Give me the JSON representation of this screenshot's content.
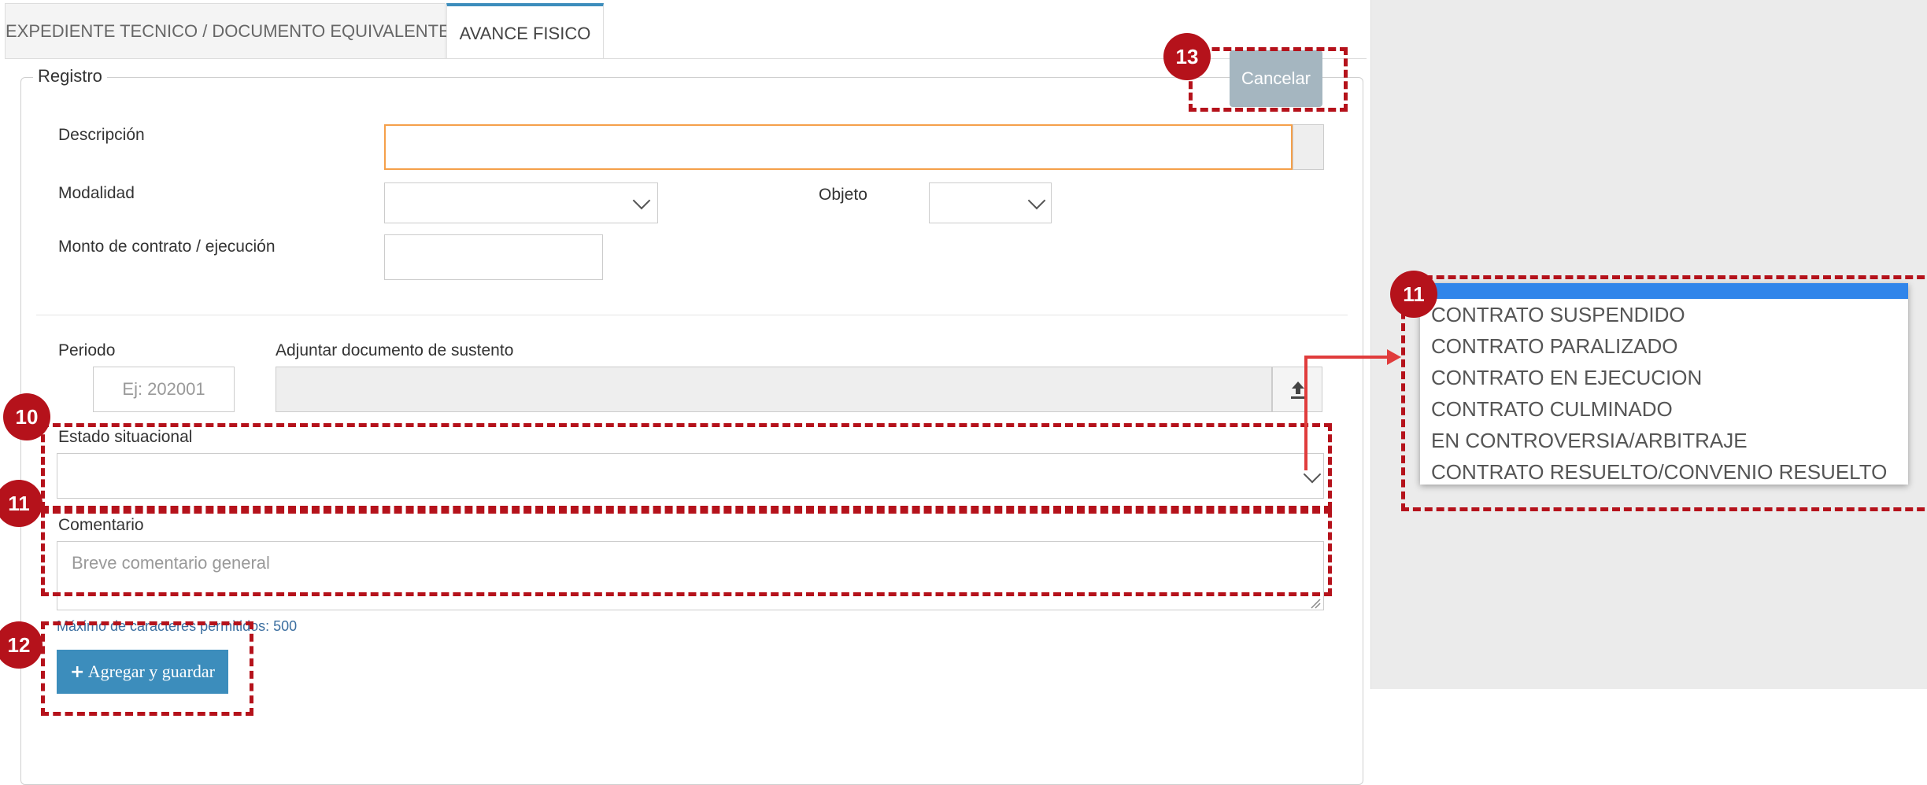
{
  "tabs": [
    {
      "label": "EXPEDIENTE TECNICO / DOCUMENTO EQUIVALENTE"
    },
    {
      "label": "AVANCE FISICO"
    }
  ],
  "form": {
    "legend": "Registro",
    "cancel_label": "Cancelar",
    "descripcion_label": "Descripción",
    "modalidad_label": "Modalidad",
    "objeto_label": "Objeto",
    "monto_label": "Monto de contrato / ejecución",
    "periodo_label": "Periodo",
    "periodo_placeholder": "Ej: 202001",
    "adjuntar_label": "Adjuntar documento de sustento",
    "estado_label": "Estado situacional",
    "comentario_label": "Comentario",
    "comentario_placeholder": "Breve comentario general",
    "max_chars_note": "Máximo de caracteres permitidos: 500",
    "add_button_label": "Agregar y guardar",
    "add_button_icon": "plus-icon",
    "upload_icon": "upload-icon"
  },
  "dropdown": {
    "options": [
      "CONTRATO SUSPENDIDO",
      "CONTRATO PARALIZADO",
      "CONTRATO EN EJECUCION",
      "CONTRATO CULMINADO",
      "EN CONTROVERSIA/ARBITRAJE",
      "CONTRATO RESUELTO/CONVENIO RESUELTO"
    ]
  },
  "annotations": {
    "badges": [
      "13",
      "11",
      "10",
      "11",
      "12"
    ]
  },
  "colors": {
    "annotation_red": "#b5121b",
    "tab_active_accent": "#3c8dbc",
    "primary_button": "#3c8dbc",
    "cancel_button": "#a5b6c0",
    "input_focus_border": "#f5a04a",
    "dropdown_highlight": "#3085ea"
  }
}
